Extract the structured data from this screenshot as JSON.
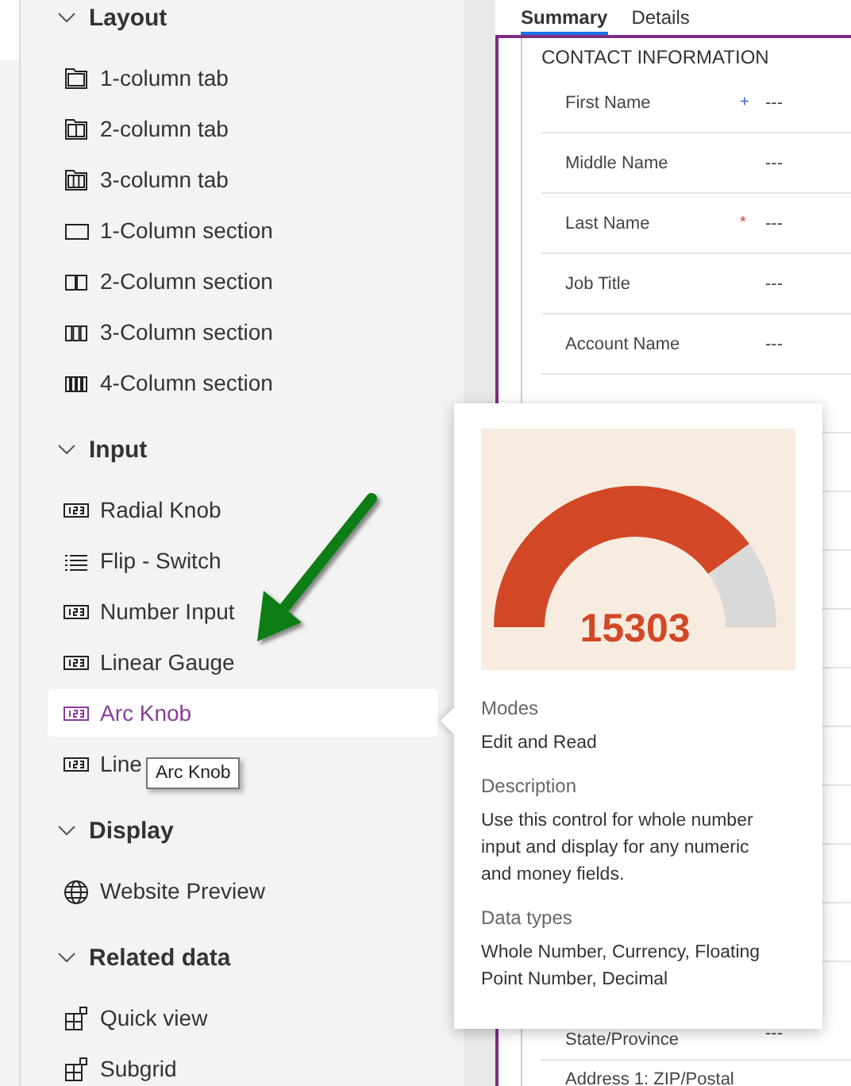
{
  "sidebar": {
    "groups": [
      {
        "title": "Layout",
        "expanded": true,
        "items": [
          {
            "label": "1-column tab",
            "kind": "tab",
            "selected": false
          },
          {
            "label": "2-column tab",
            "kind": "tab",
            "selected": false
          },
          {
            "label": "3-column tab",
            "kind": "tab",
            "selected": false
          },
          {
            "label": "1-Column section",
            "kind": "section",
            "selected": false
          },
          {
            "label": "2-Column section",
            "kind": "section",
            "selected": false
          },
          {
            "label": "3-Column section",
            "kind": "section",
            "selected": false
          },
          {
            "label": "4-Column section",
            "kind": "section",
            "selected": false
          }
        ]
      },
      {
        "title": "Input",
        "expanded": true,
        "items": [
          {
            "label": "Radial Knob",
            "kind": "number",
            "selected": false
          },
          {
            "label": "Flip - Switch",
            "kind": "list",
            "selected": false
          },
          {
            "label": "Number Input",
            "kind": "number",
            "selected": false
          },
          {
            "label": "Linear Gauge",
            "kind": "number",
            "selected": false
          },
          {
            "label": "Arc Knob",
            "kind": "number",
            "selected": true
          },
          {
            "label": "Line",
            "kind": "number",
            "selected": false
          }
        ]
      },
      {
        "title": "Display",
        "expanded": true,
        "items": [
          {
            "label": "Website Preview",
            "kind": "globe",
            "selected": false
          }
        ]
      },
      {
        "title": "Related data",
        "expanded": true,
        "items": [
          {
            "label": "Quick view",
            "kind": "grid",
            "selected": false
          },
          {
            "label": "Subgrid",
            "kind": "grid",
            "selected": false
          }
        ]
      }
    ]
  },
  "tooltip": "Arc Knob",
  "form": {
    "tabs": [
      {
        "label": "Summary",
        "selected": true
      },
      {
        "label": "Details",
        "selected": false
      }
    ],
    "section_title": "CONTACT INFORMATION",
    "fields": [
      {
        "label": "First Name",
        "marker": "+",
        "color": "#2b58d6",
        "value": "---"
      },
      {
        "label": "Middle Name",
        "value": "---"
      },
      {
        "label": "Last Name",
        "marker": "*",
        "color": "#e0443a",
        "value": "---"
      },
      {
        "label": "Job Title",
        "value": "---"
      },
      {
        "label": "Account Name",
        "value": "---"
      }
    ],
    "lower_fields": [
      {
        "label": "State/Province",
        "value": "---"
      },
      {
        "label": "Address 1: ZIP/Postal"
      }
    ]
  },
  "popup": {
    "preview": {
      "value": "15303"
    },
    "sections": [
      {
        "heading": "Modes",
        "text": "Edit and Read"
      },
      {
        "heading": "Description",
        "text": "Use this control for whole number input and display for any numeric and money fields."
      },
      {
        "heading": "Data types",
        "text": "Whole Number, Currency, Floating Point Number, Decimal"
      }
    ]
  }
}
